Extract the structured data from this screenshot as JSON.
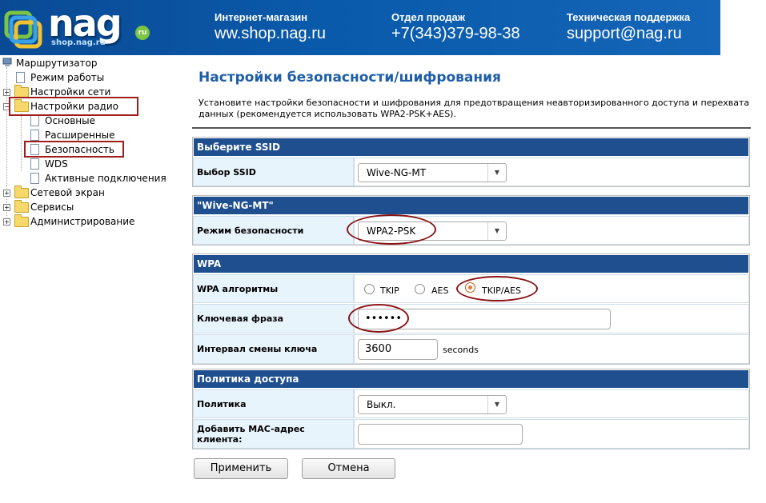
{
  "header": {
    "logo_text": "nag",
    "logo_sub": "shop.nag.ru",
    "logo_badge": "ru",
    "shop_caption": "Интернет-магазин",
    "shop_value": "ww.shop.nag.ru",
    "sales_caption": "Отдел продаж",
    "sales_value": "+7(343)379-98-38",
    "support_caption": "Техническая поддержка",
    "support_value": "support@nag.ru"
  },
  "sidebar": {
    "root": "Маршрутизатор",
    "items": [
      {
        "label": "Режим работы"
      },
      {
        "label": "Настройки сети"
      },
      {
        "label": "Настройки радио"
      },
      {
        "label": "Основные"
      },
      {
        "label": "Расширенные"
      },
      {
        "label": "Безопасность"
      },
      {
        "label": "WDS"
      },
      {
        "label": "Активные подключения"
      },
      {
        "label": "Сетевой экран"
      },
      {
        "label": "Сервисы"
      },
      {
        "label": "Администрирование"
      }
    ]
  },
  "main": {
    "title": "Настройки безопасности/шифрования",
    "description": "Установите настройки безопасности и шифрования для предотвращения неавторизированного доступа и перехвата данных (рекомендуется использовать WPA2-PSK+AES).",
    "ssid_section": {
      "header": "Выберите SSID",
      "label": "Выбор SSID",
      "value": "Wive-NG-MT"
    },
    "security_section": {
      "header": "\"Wive-NG-MT\"",
      "label": "Режим безопасности",
      "value": "WPA2-PSK"
    },
    "wpa_section": {
      "header": "WPA",
      "algo_label": "WPA алгоритмы",
      "algo_options": [
        "TKIP",
        "AES",
        "TKIP/AES"
      ],
      "algo_selected": "TKIP/AES",
      "key_label": "Ключевая фраза",
      "key_value": "••••••",
      "interval_label": "Интервал смены ключа",
      "interval_value": "3600",
      "interval_unit": "seconds"
    },
    "policy_section": {
      "header": "Политика доступа",
      "policy_label": "Политика",
      "policy_value": "Выкл.",
      "mac_label": "Добавить MAC-адрес клиента:",
      "mac_value": ""
    },
    "buttons": {
      "apply": "Применить",
      "cancel": "Отмена"
    }
  },
  "colors": {
    "section_header": "#1f4f8e",
    "label_cell": "#e8f4fc",
    "title": "#1f5ea8",
    "highlight": "#a01c1c"
  }
}
